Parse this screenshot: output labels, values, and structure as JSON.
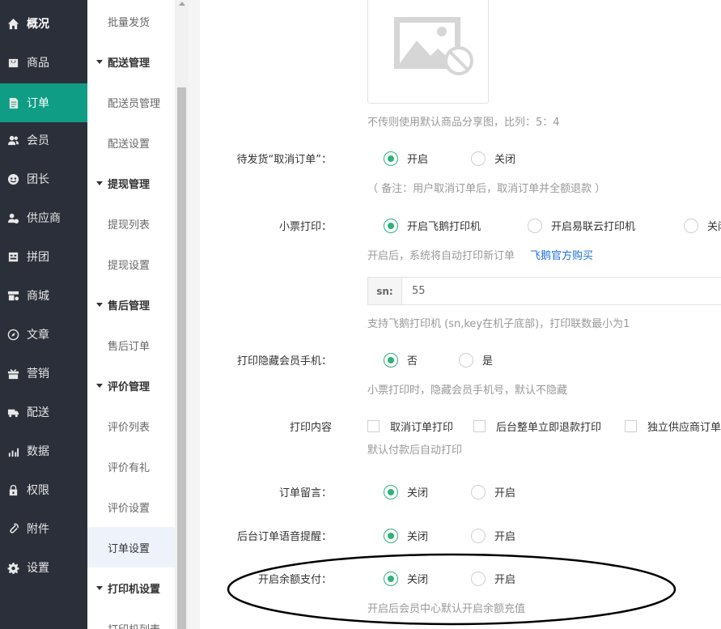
{
  "nav": {
    "items": [
      {
        "label": "概况",
        "icon": "home-icon"
      },
      {
        "label": "商品",
        "icon": "goods-icon"
      },
      {
        "label": "订单",
        "icon": "order-icon"
      },
      {
        "label": "会员",
        "icon": "members-icon"
      },
      {
        "label": "团长",
        "icon": "leader-icon"
      },
      {
        "label": "供应商",
        "icon": "supplier-icon"
      },
      {
        "label": "拼团",
        "icon": "group-buy-icon"
      },
      {
        "label": "商城",
        "icon": "mall-icon"
      },
      {
        "label": "文章",
        "icon": "compass-icon"
      },
      {
        "label": "营销",
        "icon": "gift-icon"
      },
      {
        "label": "配送",
        "icon": "truck-icon"
      },
      {
        "label": "数据",
        "icon": "chart-icon"
      },
      {
        "label": "权限",
        "icon": "lock-icon"
      },
      {
        "label": "附件",
        "icon": "paperclip-icon"
      },
      {
        "label": "设置",
        "icon": "gear-icon"
      }
    ],
    "active": "订单",
    "active_color": "#0f9d85"
  },
  "submenu": {
    "batch_ship": "批量发货",
    "delivery_group": "配送管理",
    "delivery_staff": "配送员管理",
    "delivery_settings": "配送设置",
    "withdraw_group": "提现管理",
    "withdraw_list": "提现列表",
    "withdraw_settings": "提现设置",
    "aftersale_group": "售后管理",
    "aftersale_orders": "售后订单",
    "review_group": "评价管理",
    "review_list": "评价列表",
    "review_gift": "评价有礼",
    "review_settings": "评价设置",
    "order_settings": "订单设置",
    "printer_group": "打印机设置",
    "printer_list": "打印机列表"
  },
  "form": {
    "share_image_help": "不传则使用默认商品分享图，比列：5：4",
    "cancel_pending": {
      "label": "待发货“取消订单”：",
      "options": [
        "开启",
        "关闭"
      ],
      "selected": "开启",
      "note": "（ 备注：用户取消订单后，取消订单并全额退款 ）"
    },
    "receipt_print": {
      "label": "小票打印：",
      "options": [
        "开启飞鹅打印机",
        "开启易联云打印机",
        "关闭"
      ],
      "selected": "开启飞鹅打印机",
      "help": "开启后，系统将自动打印新订单",
      "buy_link": "飞鹅官方购买",
      "sn_addon": "sn:",
      "sn_value": "55",
      "sn_help": "支持飞鹅打印机 (sn,key在机子底部)，打印联数最小为1"
    },
    "hide_phone": {
      "label": "打印隐藏会员手机：",
      "options": [
        "否",
        "是"
      ],
      "selected": "否",
      "help": "小票打印时，隐藏会员手机号，默认不隐藏"
    },
    "print_content": {
      "label": "打印内容",
      "options": [
        "取消订单打印",
        "后台整单立即退款打印",
        "独立供应商订单"
      ],
      "help": "默认付款后自动打印"
    },
    "order_message": {
      "label": "订单留言：",
      "options": [
        "关闭",
        "开启"
      ],
      "selected": "关闭"
    },
    "voice_alert": {
      "label": "后台订单语音提醒：",
      "options": [
        "关闭",
        "开启"
      ],
      "selected": "关闭"
    },
    "balance_pay": {
      "label": "开启余额支付：",
      "options": [
        "关闭",
        "开启"
      ],
      "selected": "关闭",
      "help": "开启后会员中心默认开启余额充值"
    }
  },
  "colors": {
    "radio_checked": "#2fb37a",
    "link": "#1e6fd9",
    "nav_bg": "#2b2f3a"
  }
}
